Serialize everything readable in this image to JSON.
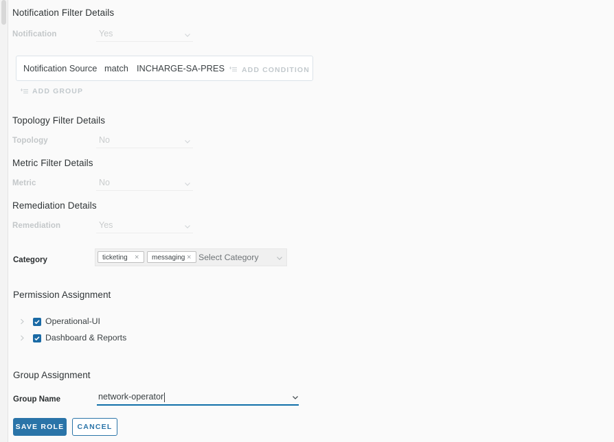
{
  "sections": {
    "notification_filter": "Notification Filter Details",
    "topology_filter": "Topology Filter Details",
    "metric_filter": "Metric Filter Details",
    "remediation": "Remediation Details",
    "permission_assignment": "Permission Assignment",
    "group_assignment": "Group Assignment"
  },
  "notification": {
    "label": "Notification",
    "value": "Yes",
    "condition": {
      "field": "Notification Source",
      "operator": "match",
      "value": "INCHARGE-SA-PRES"
    },
    "add_condition_label": "ADD CONDITION",
    "add_group_label": "ADD GROUP"
  },
  "topology": {
    "label": "Topology",
    "value": "No"
  },
  "metric": {
    "label": "Metric",
    "value": "No"
  },
  "remediation": {
    "label": "Remediation",
    "value": "Yes"
  },
  "category": {
    "label": "Category",
    "placeholder": "Select Category",
    "tags": [
      {
        "label": "ticketing",
        "remove": "×"
      },
      {
        "label": "messaging",
        "remove": "×"
      }
    ]
  },
  "permissions": [
    {
      "label": "Operational-UI",
      "checked": true
    },
    {
      "label": "Dashboard & Reports",
      "checked": true
    }
  ],
  "group": {
    "name_label": "Group Name",
    "name_value": "network-operator"
  },
  "buttons": {
    "save": "SAVE ROLE",
    "cancel": "CANCEL"
  },
  "colors": {
    "accent_blue": "#2a74a8",
    "checkbox_blue": "#1a6aa5",
    "focus_underline": "#0f6fa8",
    "background": "#fafafa",
    "muted_text": "#c3c7c9"
  }
}
